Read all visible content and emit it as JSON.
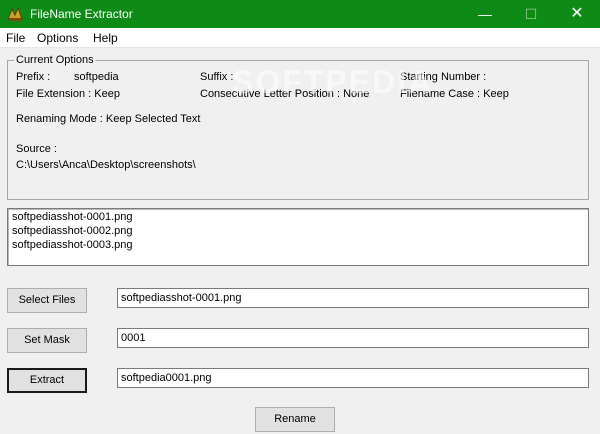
{
  "window": {
    "title": "FileName Extractor",
    "minimize_glyph": "—",
    "maximize_glyph": "☐",
    "close_glyph": "✕",
    "titlebar_color": "#0e8a16"
  },
  "menu": [
    "File",
    "Options",
    "Help"
  ],
  "options": {
    "group_title": "Current Options",
    "prefix_label": "Prefix :",
    "prefix_value": "softpedia",
    "suffix_label": "Suffix :",
    "starting_number_label": "Starting Number :",
    "file_extension": "File Extension : Keep",
    "consecutive_letter_position": "Consecutive Letter Position : None",
    "filename_case": "Filename Case : Keep",
    "renaming_mode": "Renaming Mode : Keep Selected Text",
    "source_label": "Source :",
    "source_path": "C:\\Users\\Anca\\Desktop\\screenshots\\"
  },
  "files": [
    "softpediasshot-0001.png",
    "softpediasshot-0002.png",
    "softpediasshot-0003.png"
  ],
  "actions": {
    "select_files_label": "Select Files",
    "select_files_value": "softpediasshot-0001.png",
    "set_mask_label": "Set Mask",
    "mask_value": "0001",
    "extract_label": "Extract",
    "extract_value": "softpedia0001.png",
    "rename_label": "Rename"
  },
  "watermark": "SOFTPEDIA",
  "icons": {
    "app": "app-logo-icon"
  }
}
